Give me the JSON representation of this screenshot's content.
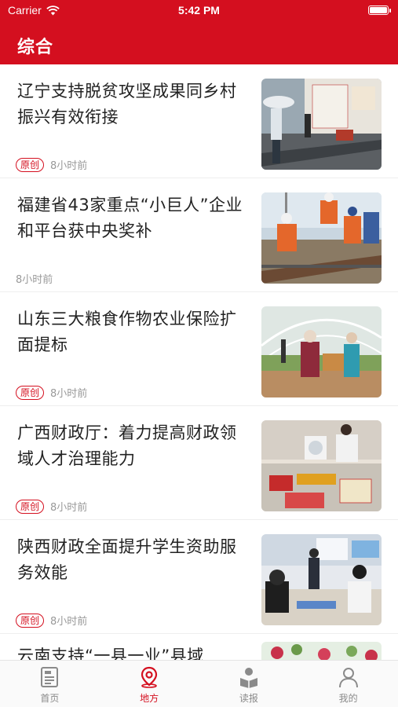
{
  "status_bar": {
    "carrier": "Carrier",
    "time": "5:42 PM",
    "wifi_icon": "wifi-icon",
    "battery_icon": "battery-icon"
  },
  "header": {
    "title": "综合"
  },
  "articles": [
    {
      "title": "辽宁支持脱贫攻坚成果同乡村振兴有效衔接",
      "badge": "原创",
      "time": "8小时前",
      "image": "photo-rural-village-wall"
    },
    {
      "title": "福建省43家重点“小巨人”企业和平台获中央奖补",
      "badge": "",
      "time": "8小时前",
      "image": "photo-railway-workers"
    },
    {
      "title": "山东三大粮食作物农业保险扩面提标",
      "badge": "原创",
      "time": "8小时前",
      "image": "photo-greenhouse-farmers"
    },
    {
      "title": "广西财政厅：着力提高财政领域人才治理能力",
      "badge": "原创",
      "time": "8小时前",
      "image": "photo-certificates-table"
    },
    {
      "title": "陕西财政全面提升学生资助服务效能",
      "badge": "原创",
      "time": "8小时前",
      "image": "photo-student-aid-hall"
    },
    {
      "title": "云南支持“一县一业”县域",
      "badge": "",
      "time": "",
      "image": "photo-flowers"
    }
  ],
  "tabs": [
    {
      "label": "首页",
      "icon": "newspaper-icon",
      "active": false
    },
    {
      "label": "地方",
      "icon": "location-pin-icon",
      "active": true
    },
    {
      "label": "读报",
      "icon": "reader-icon",
      "active": false
    },
    {
      "label": "我的",
      "icon": "person-icon",
      "active": false
    }
  ],
  "colors": {
    "brand": "#d40f1f",
    "tab_inactive": "#8a8a8a",
    "meta": "#999999"
  }
}
